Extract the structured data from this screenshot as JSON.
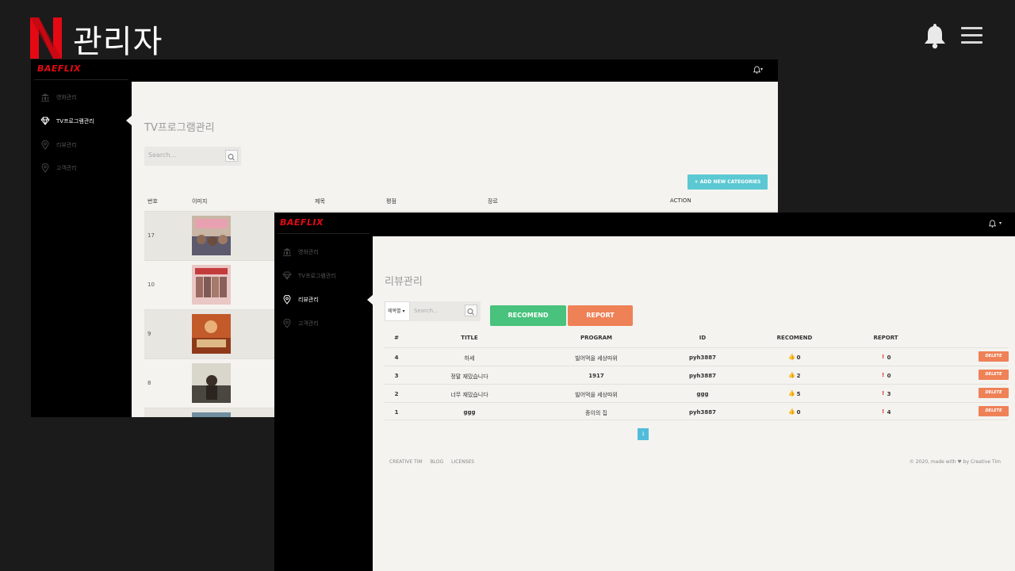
{
  "banner": {
    "title": "관리자"
  },
  "win1": {
    "brand": "BAEFLIX",
    "nav": [
      {
        "label": "영화관리",
        "icon": "bank-icon"
      },
      {
        "label": "TV프로그램관리",
        "icon": "diamond-icon"
      },
      {
        "label": "리뷰관리",
        "icon": "pin-icon"
      },
      {
        "label": "고객관리",
        "icon": "pin-icon"
      }
    ],
    "title": "TV프로그램관리",
    "search_placeholder": "Search...",
    "add_button": "+ ADD NEW CATEGORIES",
    "columns": [
      "번호",
      "이미지",
      "제목",
      "평점",
      "장르",
      "ACTION"
    ],
    "rows": [
      {
        "num": "17"
      },
      {
        "num": "10"
      },
      {
        "num": "9"
      },
      {
        "num": "8"
      }
    ]
  },
  "win2": {
    "brand": "BAEFLIX",
    "nav": [
      {
        "label": "영화관리",
        "icon": "bank-icon"
      },
      {
        "label": "TV프로그램관리",
        "icon": "diamond-icon"
      },
      {
        "label": "리뷰관리",
        "icon": "pin-icon"
      },
      {
        "label": "고객관리",
        "icon": "pin-icon"
      }
    ],
    "title": "리뷰관리",
    "select_value": "제목별 ▾",
    "search_placeholder": "Search...",
    "recomend_button": "RECOMEND",
    "report_button": "REPORT",
    "columns": [
      "#",
      "TITLE",
      "PROGRAM",
      "ID",
      "RECOMEND",
      "REPORT"
    ],
    "rows": [
      {
        "num": "4",
        "title": "하세",
        "program": "빌어먹을 세상따위",
        "id": "pyh3887",
        "recomend": "0",
        "report": "0",
        "action": "DELETE"
      },
      {
        "num": "3",
        "title": "정말 재밌습니다",
        "program": "1917",
        "id": "pyh3887",
        "recomend": "2",
        "report": "0",
        "action": "DELETE"
      },
      {
        "num": "2",
        "title": "너무 재밌습니다",
        "program": "빌어먹을 세상따위",
        "id": "ggg",
        "recomend": "5",
        "report": "3",
        "action": "DELETE"
      },
      {
        "num": "1",
        "title": "ggg",
        "program": "종이의 집",
        "id": "pyh3887",
        "recomend": "0",
        "report": "4",
        "action": "DELETE"
      }
    ],
    "page": "1",
    "footer_links": [
      "CREATIVE TIM",
      "BLOG",
      "LICENSES"
    ],
    "footer_right": "© 2020, made with ♥ by Creative Tim"
  },
  "colors": {
    "netflix_red": "#e50914",
    "add_button": "#5bc8d3",
    "recomend": "#48c27c",
    "report": "#ef8157",
    "sidebar": "#000000"
  }
}
